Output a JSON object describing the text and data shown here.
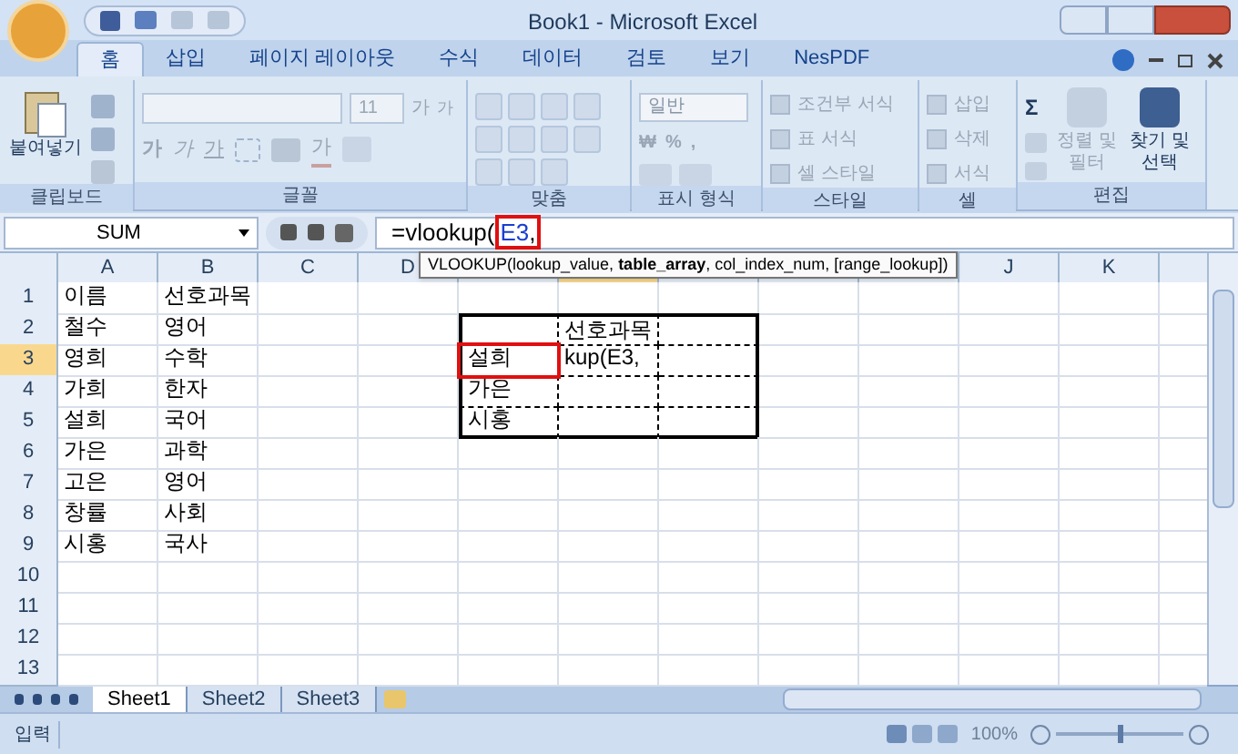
{
  "window": {
    "title": "Book1 - Microsoft Excel"
  },
  "tabs": [
    {
      "label": "홈",
      "selected": true
    },
    {
      "label": "삽입",
      "selected": false
    },
    {
      "label": "페이지 레이아웃",
      "selected": false
    },
    {
      "label": "수식",
      "selected": false
    },
    {
      "label": "데이터",
      "selected": false
    },
    {
      "label": "검토",
      "selected": false
    },
    {
      "label": "보기",
      "selected": false
    },
    {
      "label": "NesPDF",
      "selected": false
    }
  ],
  "ribbon": [
    {
      "kind": "clipboard",
      "label": "클립보드",
      "paste": {
        "label": "붙여넣기",
        "disabled": false
      }
    },
    {
      "kind": "font",
      "label": "글꼴",
      "size": "11",
      "glyphs": [
        "가",
        "가",
        "가",
        "가",
        "가",
        "가"
      ],
      "disabled": true
    },
    {
      "kind": "align",
      "label": "맞춤",
      "disabled": true
    },
    {
      "kind": "number",
      "label": "표시 형식",
      "format": "일반",
      "symbols": [
        "₩",
        "%",
        ","
      ],
      "disabled": true
    },
    {
      "kind": "list",
      "label": "스타일",
      "items": [
        {
          "label": "조건부 서식",
          "disabled": true
        },
        {
          "label": "표 서식",
          "disabled": true
        },
        {
          "label": "셀 스타일",
          "disabled": true
        }
      ]
    },
    {
      "kind": "list",
      "label": "셀",
      "items": [
        {
          "label": "삽입",
          "disabled": true
        },
        {
          "label": "삭제",
          "disabled": true
        },
        {
          "label": "서식",
          "disabled": true
        }
      ]
    },
    {
      "kind": "edit",
      "label": "편집",
      "sigma": "Σ",
      "items": [
        {
          "label": "정렬 및 필터",
          "disabled": true
        },
        {
          "label": "찾기 및 선택",
          "disabled": false
        }
      ]
    }
  ],
  "formula_bar": {
    "name_box": "SUM",
    "formula_start": "=vlookup(",
    "formula_ref": "E3",
    "formula_end": ",",
    "tooltip": "VLOOKUP(lookup_value, **table_array**, col_index_num, [range_lookup])"
  },
  "columns": [
    {
      "label": "A",
      "selected": false
    },
    {
      "label": "B",
      "selected": false
    },
    {
      "label": "C",
      "selected": false
    },
    {
      "label": "D",
      "selected": false
    },
    {
      "selected": false
    },
    {
      "selected": true
    },
    {
      "selected": false
    },
    {
      "selected": false
    },
    {
      "selected": false
    },
    {
      "label": "J",
      "selected": false
    },
    {
      "label": "K",
      "selected": false
    }
  ],
  "rows": [
    {
      "header": "1",
      "selected": false,
      "cells": {
        "A": {
          "text": "이름",
          "active": false,
          "in_table": false
        },
        "B": {
          "text": "선호과목",
          "active": false,
          "in_table": false
        }
      }
    },
    {
      "header": "2",
      "selected": false,
      "cells": {
        "A": {
          "text": "철수",
          "active": false,
          "in_table": false
        },
        "B": {
          "text": "영어",
          "active": false,
          "in_table": false
        },
        "E": {
          "active": false,
          "in_table": true
        },
        "F": {
          "text": "선호과목",
          "active": false,
          "in_table": true
        },
        "G": {
          "active": false,
          "in_table": true
        }
      }
    },
    {
      "header": "3",
      "selected": true,
      "cells": {
        "A": {
          "text": "영희",
          "active": false,
          "in_table": false
        },
        "B": {
          "text": "수학",
          "active": false,
          "in_table": false
        },
        "E": {
          "text": "설희",
          "active": true,
          "in_table": true
        },
        "F": {
          "text": "kup(E3,",
          "active": false,
          "in_table": true
        },
        "G": {
          "active": false,
          "in_table": true
        }
      }
    },
    {
      "header": "4",
      "selected": false,
      "cells": {
        "A": {
          "text": "가희",
          "active": false,
          "in_table": false
        },
        "B": {
          "text": "한자",
          "active": false,
          "in_table": false
        },
        "E": {
          "text": "가은",
          "active": false,
          "in_table": true
        },
        "F": {
          "active": false,
          "in_table": true
        },
        "G": {
          "active": false,
          "in_table": true
        }
      }
    },
    {
      "header": "5",
      "selected": false,
      "cells": {
        "A": {
          "text": "설희",
          "active": false,
          "in_table": false
        },
        "B": {
          "text": "국어",
          "active": false,
          "in_table": false
        },
        "E": {
          "text": "시홍",
          "active": false,
          "in_table": true
        },
        "F": {
          "active": false,
          "in_table": true
        },
        "G": {
          "active": false,
          "in_table": true
        }
      }
    },
    {
      "header": "6",
      "selected": false,
      "cells": {
        "A": {
          "text": "가은",
          "active": false,
          "in_table": false
        },
        "B": {
          "text": "과학",
          "active": false,
          "in_table": false
        }
      }
    },
    {
      "header": "7",
      "selected": false,
      "cells": {
        "A": {
          "text": "고은",
          "active": false,
          "in_table": false
        },
        "B": {
          "text": "영어",
          "active": false,
          "in_table": false
        }
      }
    },
    {
      "header": "8",
      "selected": false,
      "cells": {
        "A": {
          "text": "창률",
          "active": false,
          "in_table": false
        },
        "B": {
          "text": "사회",
          "active": false,
          "in_table": false
        }
      }
    },
    {
      "header": "9",
      "selected": false,
      "cells": {
        "A": {
          "text": "시홍",
          "active": false,
          "in_table": false
        },
        "B": {
          "text": "국사",
          "active": false,
          "in_table": false
        }
      }
    },
    {
      "header": "10",
      "selected": false,
      "cells": {}
    },
    {
      "header": "11",
      "selected": false,
      "cells": {}
    },
    {
      "header": "12",
      "selected": false,
      "cells": {}
    },
    {
      "header": "13",
      "selected": false,
      "cells": {}
    }
  ],
  "sheets": [
    {
      "label": "Sheet1",
      "selected": true
    },
    {
      "label": "Sheet2",
      "selected": false
    },
    {
      "label": "Sheet3",
      "selected": false
    }
  ],
  "status_bar": {
    "mode": "입력",
    "zoom": "100%",
    "zoom_slider": {
      "level": 0.5
    }
  }
}
